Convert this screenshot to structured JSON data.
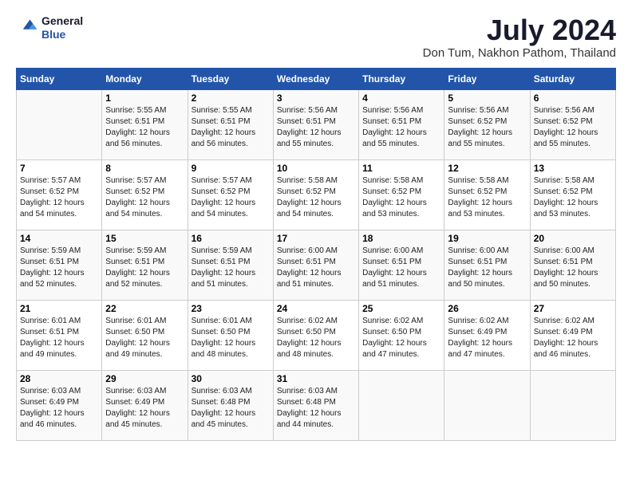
{
  "header": {
    "logo_line1": "General",
    "logo_line2": "Blue",
    "title": "July 2024",
    "subtitle": "Don Tum, Nakhon Pathom, Thailand"
  },
  "columns": [
    "Sunday",
    "Monday",
    "Tuesday",
    "Wednesday",
    "Thursday",
    "Friday",
    "Saturday"
  ],
  "weeks": [
    [
      {
        "day": "",
        "sunrise": "",
        "sunset": "",
        "daylight": ""
      },
      {
        "day": "1",
        "sunrise": "Sunrise: 5:55 AM",
        "sunset": "Sunset: 6:51 PM",
        "daylight": "Daylight: 12 hours and 56 minutes."
      },
      {
        "day": "2",
        "sunrise": "Sunrise: 5:55 AM",
        "sunset": "Sunset: 6:51 PM",
        "daylight": "Daylight: 12 hours and 56 minutes."
      },
      {
        "day": "3",
        "sunrise": "Sunrise: 5:56 AM",
        "sunset": "Sunset: 6:51 PM",
        "daylight": "Daylight: 12 hours and 55 minutes."
      },
      {
        "day": "4",
        "sunrise": "Sunrise: 5:56 AM",
        "sunset": "Sunset: 6:51 PM",
        "daylight": "Daylight: 12 hours and 55 minutes."
      },
      {
        "day": "5",
        "sunrise": "Sunrise: 5:56 AM",
        "sunset": "Sunset: 6:52 PM",
        "daylight": "Daylight: 12 hours and 55 minutes."
      },
      {
        "day": "6",
        "sunrise": "Sunrise: 5:56 AM",
        "sunset": "Sunset: 6:52 PM",
        "daylight": "Daylight: 12 hours and 55 minutes."
      }
    ],
    [
      {
        "day": "7",
        "sunrise": "Sunrise: 5:57 AM",
        "sunset": "Sunset: 6:52 PM",
        "daylight": "Daylight: 12 hours and 54 minutes."
      },
      {
        "day": "8",
        "sunrise": "Sunrise: 5:57 AM",
        "sunset": "Sunset: 6:52 PM",
        "daylight": "Daylight: 12 hours and 54 minutes."
      },
      {
        "day": "9",
        "sunrise": "Sunrise: 5:57 AM",
        "sunset": "Sunset: 6:52 PM",
        "daylight": "Daylight: 12 hours and 54 minutes."
      },
      {
        "day": "10",
        "sunrise": "Sunrise: 5:58 AM",
        "sunset": "Sunset: 6:52 PM",
        "daylight": "Daylight: 12 hours and 54 minutes."
      },
      {
        "day": "11",
        "sunrise": "Sunrise: 5:58 AM",
        "sunset": "Sunset: 6:52 PM",
        "daylight": "Daylight: 12 hours and 53 minutes."
      },
      {
        "day": "12",
        "sunrise": "Sunrise: 5:58 AM",
        "sunset": "Sunset: 6:52 PM",
        "daylight": "Daylight: 12 hours and 53 minutes."
      },
      {
        "day": "13",
        "sunrise": "Sunrise: 5:58 AM",
        "sunset": "Sunset: 6:52 PM",
        "daylight": "Daylight: 12 hours and 53 minutes."
      }
    ],
    [
      {
        "day": "14",
        "sunrise": "Sunrise: 5:59 AM",
        "sunset": "Sunset: 6:51 PM",
        "daylight": "Daylight: 12 hours and 52 minutes."
      },
      {
        "day": "15",
        "sunrise": "Sunrise: 5:59 AM",
        "sunset": "Sunset: 6:51 PM",
        "daylight": "Daylight: 12 hours and 52 minutes."
      },
      {
        "day": "16",
        "sunrise": "Sunrise: 5:59 AM",
        "sunset": "Sunset: 6:51 PM",
        "daylight": "Daylight: 12 hours and 51 minutes."
      },
      {
        "day": "17",
        "sunrise": "Sunrise: 6:00 AM",
        "sunset": "Sunset: 6:51 PM",
        "daylight": "Daylight: 12 hours and 51 minutes."
      },
      {
        "day": "18",
        "sunrise": "Sunrise: 6:00 AM",
        "sunset": "Sunset: 6:51 PM",
        "daylight": "Daylight: 12 hours and 51 minutes."
      },
      {
        "day": "19",
        "sunrise": "Sunrise: 6:00 AM",
        "sunset": "Sunset: 6:51 PM",
        "daylight": "Daylight: 12 hours and 50 minutes."
      },
      {
        "day": "20",
        "sunrise": "Sunrise: 6:00 AM",
        "sunset": "Sunset: 6:51 PM",
        "daylight": "Daylight: 12 hours and 50 minutes."
      }
    ],
    [
      {
        "day": "21",
        "sunrise": "Sunrise: 6:01 AM",
        "sunset": "Sunset: 6:51 PM",
        "daylight": "Daylight: 12 hours and 49 minutes."
      },
      {
        "day": "22",
        "sunrise": "Sunrise: 6:01 AM",
        "sunset": "Sunset: 6:50 PM",
        "daylight": "Daylight: 12 hours and 49 minutes."
      },
      {
        "day": "23",
        "sunrise": "Sunrise: 6:01 AM",
        "sunset": "Sunset: 6:50 PM",
        "daylight": "Daylight: 12 hours and 48 minutes."
      },
      {
        "day": "24",
        "sunrise": "Sunrise: 6:02 AM",
        "sunset": "Sunset: 6:50 PM",
        "daylight": "Daylight: 12 hours and 48 minutes."
      },
      {
        "day": "25",
        "sunrise": "Sunrise: 6:02 AM",
        "sunset": "Sunset: 6:50 PM",
        "daylight": "Daylight: 12 hours and 47 minutes."
      },
      {
        "day": "26",
        "sunrise": "Sunrise: 6:02 AM",
        "sunset": "Sunset: 6:49 PM",
        "daylight": "Daylight: 12 hours and 47 minutes."
      },
      {
        "day": "27",
        "sunrise": "Sunrise: 6:02 AM",
        "sunset": "Sunset: 6:49 PM",
        "daylight": "Daylight: 12 hours and 46 minutes."
      }
    ],
    [
      {
        "day": "28",
        "sunrise": "Sunrise: 6:03 AM",
        "sunset": "Sunset: 6:49 PM",
        "daylight": "Daylight: 12 hours and 46 minutes."
      },
      {
        "day": "29",
        "sunrise": "Sunrise: 6:03 AM",
        "sunset": "Sunset: 6:49 PM",
        "daylight": "Daylight: 12 hours and 45 minutes."
      },
      {
        "day": "30",
        "sunrise": "Sunrise: 6:03 AM",
        "sunset": "Sunset: 6:48 PM",
        "daylight": "Daylight: 12 hours and 45 minutes."
      },
      {
        "day": "31",
        "sunrise": "Sunrise: 6:03 AM",
        "sunset": "Sunset: 6:48 PM",
        "daylight": "Daylight: 12 hours and 44 minutes."
      },
      {
        "day": "",
        "sunrise": "",
        "sunset": "",
        "daylight": ""
      },
      {
        "day": "",
        "sunrise": "",
        "sunset": "",
        "daylight": ""
      },
      {
        "day": "",
        "sunrise": "",
        "sunset": "",
        "daylight": ""
      }
    ]
  ]
}
